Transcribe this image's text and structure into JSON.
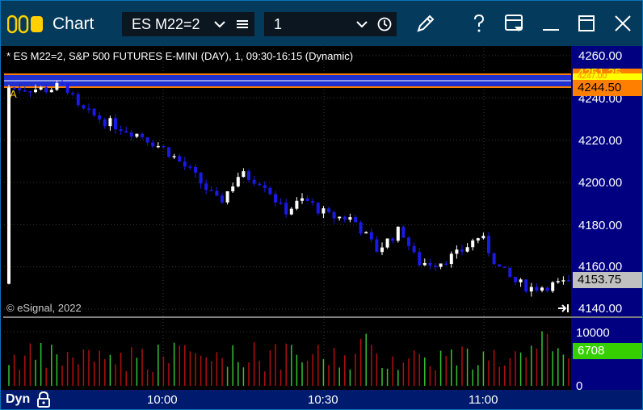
{
  "window": {
    "title": "Chart",
    "symbol": "ES M22=2",
    "interval": "1"
  },
  "chart": {
    "header": "* ES M22=2, S&P 500 FUTURES E-MINI (DAY), 1, 09:30-16:15 (Dynamic)",
    "copyright": "© eSignal, 2022",
    "price_axis": [
      "4260.00",
      "4240.00",
      "4220.00",
      "4200.00",
      "4180.00",
      "4160.00",
      "4140.00"
    ],
    "volume_axis": [
      "10000",
      "0"
    ],
    "time_axis": [
      "10:00",
      "10:30",
      "11:00"
    ],
    "price_tags": {
      "hidden_a": "4251.25",
      "hidden_b": "4247.00",
      "level": "4244.50",
      "last": "4153.75",
      "volume": "6708"
    },
    "mode_label": "Dyn",
    "colors": {
      "up": "#ffffff",
      "down": "#1a1ae6",
      "vol_up": "#36c236",
      "vol_down": "#b01010",
      "axis_bg": "#000080",
      "level_tag": "#ff7f00",
      "last_tag": "#c0c0c0",
      "vol_tag": "#36d000"
    }
  },
  "chart_data": {
    "type": "candlestick",
    "ylim": [
      4140,
      4262
    ],
    "start_close": 4245,
    "end_close": 4153.75,
    "volume_ylim": [
      0,
      10000
    ],
    "last_volume": 6708
  }
}
